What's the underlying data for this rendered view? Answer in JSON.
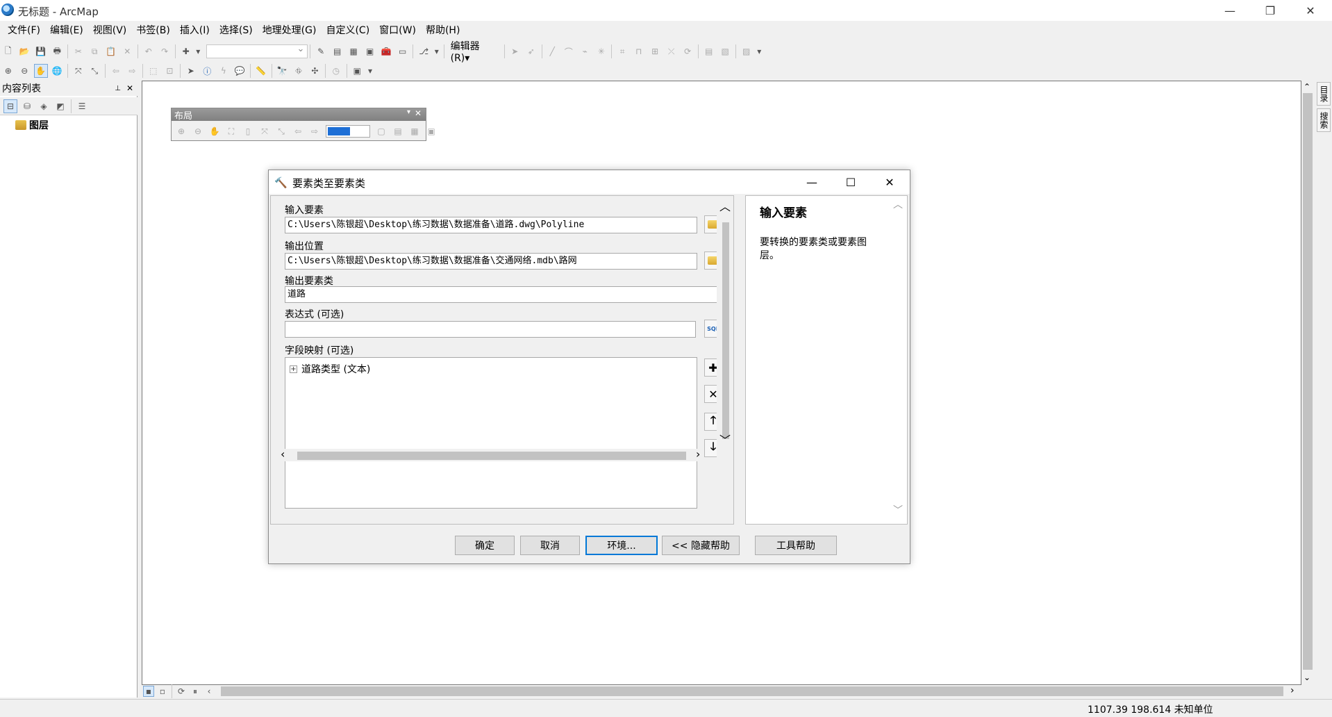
{
  "window": {
    "title": "无标题 - ArcMap",
    "minimize": "—",
    "restore": "❐",
    "close": "✕"
  },
  "menu": [
    "文件(F)",
    "编辑(E)",
    "视图(V)",
    "书签(B)",
    "插入(I)",
    "选择(S)",
    "地理处理(G)",
    "自定义(C)",
    "窗口(W)",
    "帮助(H)"
  ],
  "editor_toolbar": {
    "editor_label": "编辑器(R)▾"
  },
  "toc": {
    "title": "内容列表",
    "pin": "📌",
    "close": "✕",
    "root_layer": "图层"
  },
  "layout_toolbar": {
    "title": "布局"
  },
  "side_tabs": [
    "目录",
    "搜索"
  ],
  "status": {
    "coords": "1107.39  198.614 未知单位"
  },
  "dialog": {
    "title": "要素类至要素类",
    "input_features_label": "输入要素",
    "input_features_value": "C:\\Users\\陈银超\\Desktop\\练习数据\\数据准备\\道路.dwg\\Polyline",
    "output_location_label": "输出位置",
    "output_location_value": "C:\\Users\\陈银超\\Desktop\\练习数据\\数据准备\\交通网络.mdb\\路网",
    "output_fc_label": "输出要素类",
    "output_fc_value": "道路",
    "expression_label": "表达式 (可选)",
    "expression_value": "",
    "field_map_label": "字段映射 (可选)",
    "field_map_items": [
      "道路类型 (文本)"
    ],
    "buttons": {
      "ok": "确定",
      "cancel": "取消",
      "env": "环境...",
      "hide_help": "<< 隐藏帮助",
      "tool_help": "工具帮助"
    },
    "help": {
      "title": "输入要素",
      "text": "要转换的要素类或要素图层。"
    }
  }
}
